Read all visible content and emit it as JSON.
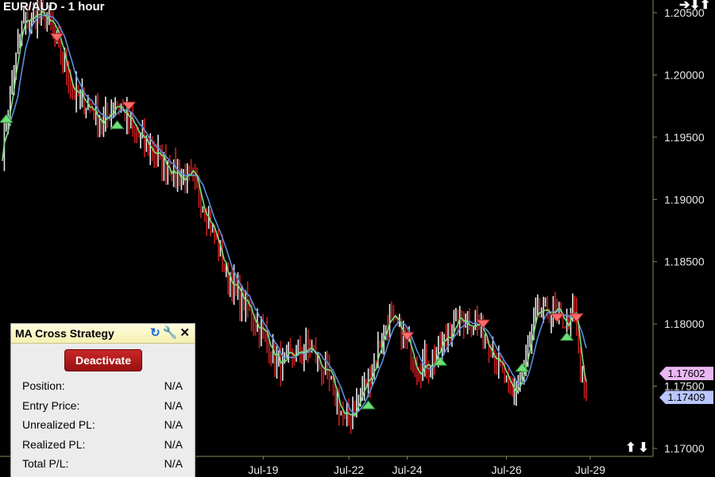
{
  "chart_data": {
    "type": "candlestick",
    "title": "EUR/AUD - 1 hour",
    "ylim": [
      1.169,
      1.207
    ],
    "y_ticks": [
      "1.20500",
      "1.20000",
      "1.19500",
      "1.19000",
      "1.18500",
      "1.18000",
      "1.17500",
      "1.17000"
    ],
    "x_ticks": [
      "Jul-19",
      "Jul-22",
      "Jul-24",
      "Jul-26",
      "Jul-29"
    ],
    "up_color": "#e6e6e6",
    "down_color": "#c81e1e",
    "fast_ma_color": "#7ae07a",
    "slow_ma_color": "#5b8fe0",
    "waypoints": [
      [
        0,
        1.194
      ],
      [
        3,
        1.1975
      ],
      [
        10,
        1.204
      ],
      [
        18,
        1.205
      ],
      [
        25,
        1.204
      ],
      [
        30,
        1.202
      ],
      [
        37,
        1.1985
      ],
      [
        45,
        1.1975
      ],
      [
        52,
        1.196
      ],
      [
        58,
        1.198
      ],
      [
        62,
        1.197
      ],
      [
        70,
        1.195
      ],
      [
        80,
        1.1935
      ],
      [
        90,
        1.192
      ],
      [
        98,
        1.1915
      ],
      [
        105,
        1.189
      ],
      [
        115,
        1.184
      ],
      [
        125,
        1.1815
      ],
      [
        135,
        1.179
      ],
      [
        143,
        1.1765
      ],
      [
        150,
        1.1775
      ],
      [
        158,
        1.178
      ],
      [
        168,
        1.1755
      ],
      [
        176,
        1.1722
      ],
      [
        182,
        1.1735
      ],
      [
        190,
        1.1765
      ],
      [
        198,
        1.1805
      ],
      [
        206,
        1.179
      ],
      [
        214,
        1.1765
      ],
      [
        222,
        1.1772
      ],
      [
        228,
        1.179
      ],
      [
        236,
        1.1805
      ],
      [
        244,
        1.18
      ],
      [
        252,
        1.178
      ],
      [
        262,
        1.174
      ],
      [
        268,
        1.1765
      ],
      [
        274,
        1.1805
      ],
      [
        282,
        1.181
      ],
      [
        290,
        1.18
      ],
      [
        294,
        1.181
      ],
      [
        297,
        1.176
      ],
      [
        300,
        1.174
      ]
    ],
    "signals": [
      {
        "type": "buy",
        "bar": 2,
        "price": 1.1965
      },
      {
        "type": "sell",
        "bar": 28,
        "price": 1.203
      },
      {
        "type": "buy",
        "bar": 59,
        "price": 1.196
      },
      {
        "type": "sell",
        "bar": 65,
        "price": 1.1975
      },
      {
        "type": "buy",
        "bar": 188,
        "price": 1.1735
      },
      {
        "type": "sell",
        "bar": 208,
        "price": 1.179
      },
      {
        "type": "buy",
        "bar": 225,
        "price": 1.177
      },
      {
        "type": "sell",
        "bar": 247,
        "price": 1.18
      },
      {
        "type": "buy",
        "bar": 267,
        "price": 1.1765
      },
      {
        "type": "sell",
        "bar": 285,
        "price": 1.1805
      },
      {
        "type": "buy",
        "bar": 290,
        "price": 1.179
      },
      {
        "type": "sell",
        "bar": 295,
        "price": 1.1805
      }
    ],
    "price_tags": [
      {
        "label": "1.17602",
        "price": 1.17602,
        "color": "#e9b8f2"
      },
      {
        "label": "1.17409",
        "price": 1.17409,
        "color": "#b9c6ff"
      }
    ]
  },
  "chart": {
    "title": "EUR/AUD - 1 hour",
    "top_nav_icons": [
      "arrow-right-icon",
      "arrow-down-icon",
      "arrow-up-icon"
    ],
    "bottom_nav_icons": [
      "arrow-up-icon",
      "arrow-down-icon"
    ]
  },
  "panel": {
    "title": "MA Cross Strategy",
    "icons": [
      "refresh-icon",
      "wrench-icon",
      "close-icon"
    ],
    "button_label": "Deactivate",
    "rows": [
      {
        "label": "Position:",
        "value": "N/A"
      },
      {
        "label": "Entry Price:",
        "value": "N/A"
      },
      {
        "label": "Unrealized PL:",
        "value": "N/A"
      },
      {
        "label": "Realized PL:",
        "value": "N/A"
      },
      {
        "label": "Total P/L:",
        "value": "N/A"
      }
    ]
  }
}
